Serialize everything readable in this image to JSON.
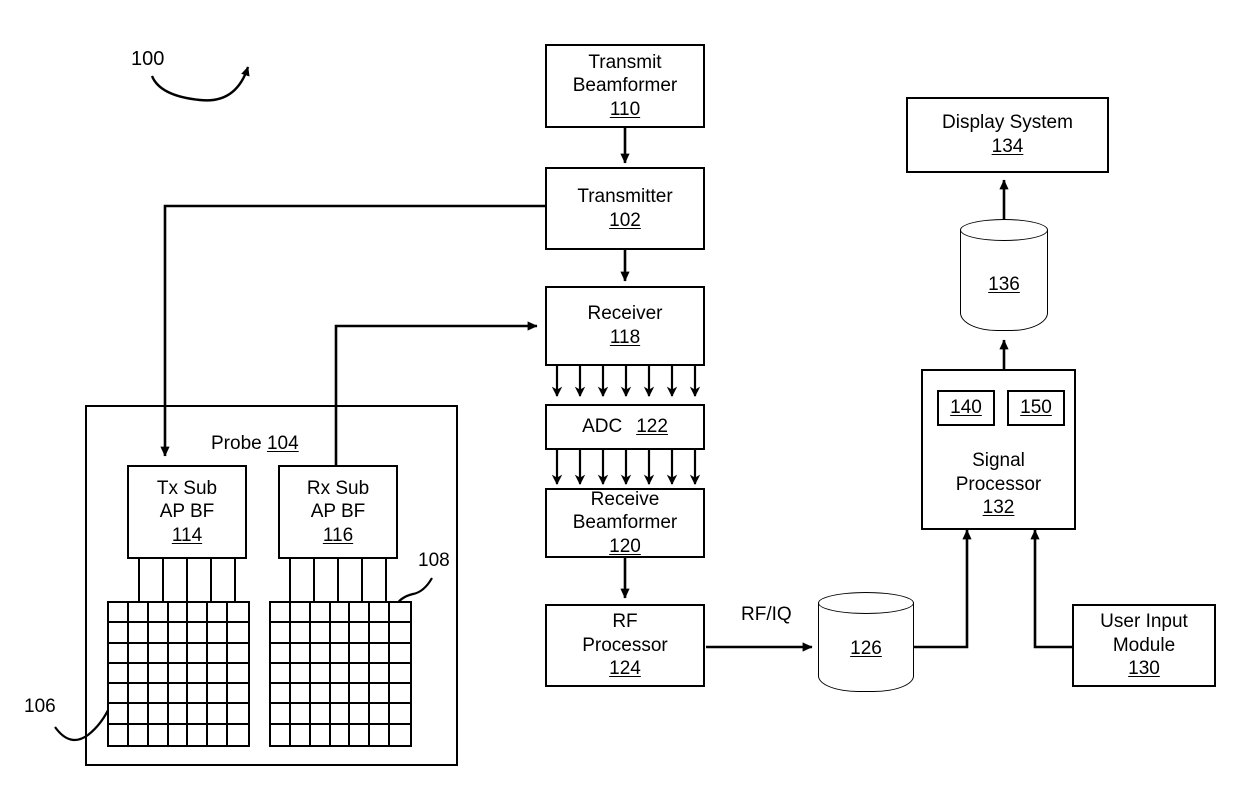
{
  "figure": {
    "number": "100",
    "title_ref": "100"
  },
  "nodes": {
    "transmit_beamformer": {
      "line1": "Transmit",
      "line2": "Beamformer",
      "ref": "110"
    },
    "transmitter": {
      "line1": "Transmitter",
      "ref": "102"
    },
    "receiver": {
      "line1": "Receiver",
      "ref": "118"
    },
    "adc": {
      "line1": "ADC",
      "ref": "122"
    },
    "receive_beamformer": {
      "line1": "Receive",
      "line2": "Beamformer",
      "ref": "120"
    },
    "rf_processor": {
      "line1": "RF",
      "line2": "Processor",
      "ref": "124"
    },
    "display_system": {
      "line1": "Display System",
      "ref": "134"
    },
    "signal_processor": {
      "line1": "Signal",
      "line2": "Processor",
      "ref": "132",
      "sub_a": "140",
      "sub_b": "150"
    },
    "user_input_module": {
      "line1": "User Input",
      "line2": "Module",
      "ref": "130"
    },
    "tx_sub_ap_bf": {
      "line1": "Tx Sub",
      "line2": "AP BF",
      "ref": "114"
    },
    "rx_sub_ap_bf": {
      "line1": "Rx Sub",
      "line2": "AP BF",
      "ref": "116"
    }
  },
  "storage": {
    "rf_iq_buffer": {
      "ref": "126"
    },
    "image_buffer": {
      "ref": "136"
    }
  },
  "labels": {
    "probe": {
      "text": "Probe",
      "ref": "104"
    },
    "rf_iq_edge": "RF/IQ",
    "callout_106": "106",
    "callout_108": "108",
    "callout_100": "100"
  },
  "arrays": {
    "tx_array": {
      "rows": 7,
      "cols": 7,
      "pins": 5
    },
    "rx_array": {
      "rows": 7,
      "cols": 7,
      "pins": 5
    }
  },
  "bus_arrows": {
    "receiver_to_adc": 7,
    "adc_to_receive_beamformer": 7
  },
  "colors": {
    "stroke": "#000000",
    "background": "#ffffff"
  }
}
